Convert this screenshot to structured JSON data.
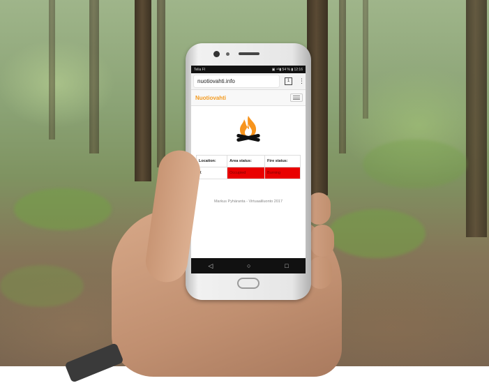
{
  "statusbar": {
    "carrier": "Telia FI",
    "indicators": "▣ ⁴ᴳ▮ 54 % ▮ 12:16"
  },
  "browser": {
    "url": "nuotiovahti.info",
    "tab_count": "1",
    "menu_glyph": "⋮"
  },
  "site": {
    "brand": "Nuotiovahti",
    "table": {
      "headers": [
        "Location:",
        "Area status:",
        "Fire status:"
      ],
      "rows": [
        {
          "location": "X",
          "area_status": "Occupied",
          "fire_status": "Burning"
        }
      ]
    },
    "footer": "Markus Pyhäranta - Virtuaaliluonto 2017"
  },
  "android_nav": {
    "back": "◁",
    "home": "○",
    "recents": "□"
  },
  "colors": {
    "brand_orange": "#f39a1e",
    "status_red": "#e90000",
    "flame_orange": "#f7941d"
  },
  "icons": [
    "campfire-icon",
    "menu-icon",
    "tabs-icon"
  ]
}
